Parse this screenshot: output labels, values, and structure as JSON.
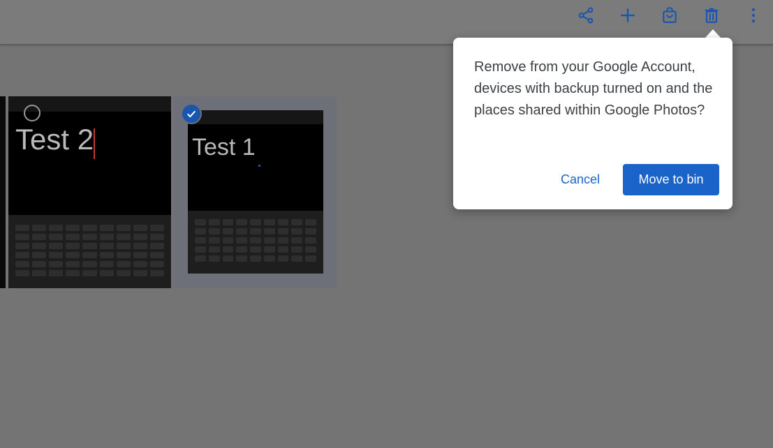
{
  "toolbar": {
    "icons": [
      "share-icon",
      "add-icon",
      "shopping-bag-icon",
      "delete-icon",
      "more-vert-icon"
    ],
    "icon_color": "#1a56b0"
  },
  "photos": [
    {
      "text": "Test 2",
      "selected": false
    },
    {
      "text": "Test 1",
      "selected": true
    }
  ],
  "dialog": {
    "message": "Remove from your Google Account, devices with backup turned on and the places shared within Google Photos?",
    "cancel_label": "Cancel",
    "confirm_label": "Move to bin",
    "accent": "#1a63c9"
  }
}
